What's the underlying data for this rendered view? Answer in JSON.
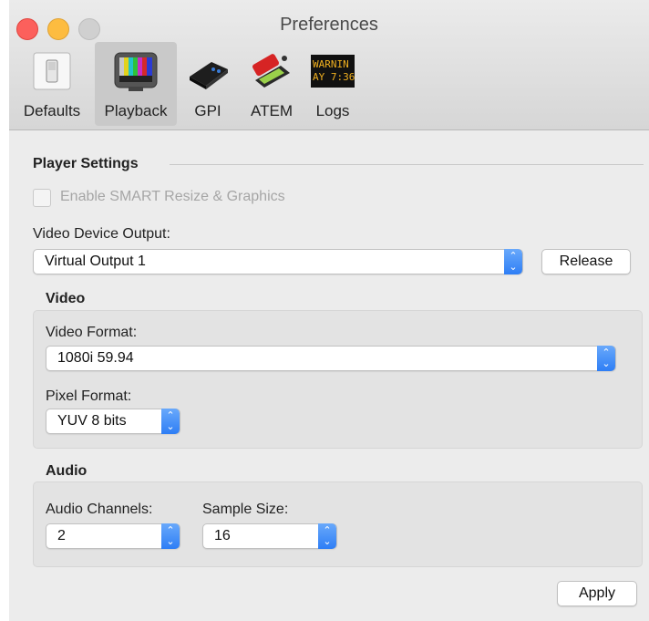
{
  "window": {
    "title": "Preferences"
  },
  "toolbar": {
    "items": [
      {
        "label": "Defaults",
        "icon": "switch-icon"
      },
      {
        "label": "Playback",
        "icon": "tv-icon"
      },
      {
        "label": "GPI",
        "icon": "gpi-device-icon"
      },
      {
        "label": "ATEM",
        "icon": "on-air-icon"
      },
      {
        "label": "Logs",
        "icon": "warning-display-icon"
      }
    ],
    "selected": "Playback",
    "logs_icon_text_line1": "WARNIN",
    "logs_icon_text_line2": "AY 7:36:"
  },
  "player_settings": {
    "title": "Player Settings",
    "smart_resize_label": "Enable SMART Resize & Graphics",
    "smart_resize_checked": false,
    "device_output_label": "Video Device Output:",
    "device_output_value": "Virtual Output 1",
    "release_button": "Release"
  },
  "video": {
    "title": "Video",
    "format_label": "Video Format:",
    "format_value": "1080i 59.94",
    "pixel_label": "Pixel Format:",
    "pixel_value": "YUV 8 bits"
  },
  "audio": {
    "title": "Audio",
    "channels_label": "Audio Channels:",
    "channels_value": "2",
    "sample_label": "Sample Size:",
    "sample_value": "16"
  },
  "apply_button": "Apply",
  "colors": {
    "accent": "#2e7ef5",
    "close": "#fc605c",
    "minimize": "#fdbc40",
    "zoom": "#d0d0d0"
  }
}
